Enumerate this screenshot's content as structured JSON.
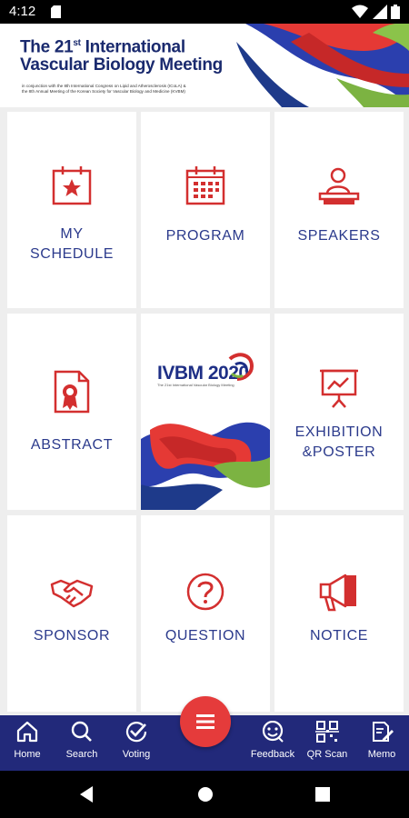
{
  "status": {
    "time": "4:12"
  },
  "banner": {
    "title_prefix": "The 21",
    "title_sup": "st",
    "title_line1_rest": " International",
    "title_line2": "Vascular Biology Meeting",
    "subtitle_line1": "in conjunction with the 8th International Congress on Lipid and Atherosclerosis (ICoLA) &",
    "subtitle_line2": "the 8th Annual Meeting of the Korean Society for Vascular Biology and Medicine (KVBM)"
  },
  "tiles": [
    {
      "line1": "MY",
      "line2": "SCHEDULE",
      "icon": "calendar-star-icon"
    },
    {
      "line1": "PROGRAM",
      "icon": "calendar-grid-icon"
    },
    {
      "line1": "SPEAKERS",
      "icon": "speaker-podium-icon"
    },
    {
      "line1": "ABSTRACT",
      "icon": "certificate-document-icon"
    },
    {
      "logo_text": "IVBM 2020",
      "logo_sub": "The 21st International Vascular Biology Meeting"
    },
    {
      "line1": "EXHIBITION",
      "line2": "&POSTER",
      "icon": "presentation-board-icon"
    },
    {
      "line1": "SPONSOR",
      "icon": "handshake-icon"
    },
    {
      "line1": "QUESTION",
      "icon": "question-circle-icon"
    },
    {
      "line1": "NOTICE",
      "icon": "megaphone-icon"
    }
  ],
  "nav": {
    "home": "Home",
    "search": "Search",
    "voting": "Voting",
    "feedback": "Feedback",
    "qr": "QR Scan",
    "memo": "Memo"
  },
  "colors": {
    "accent": "#d32f2f",
    "navy": "#22297a",
    "label": "#2b3a8c"
  }
}
